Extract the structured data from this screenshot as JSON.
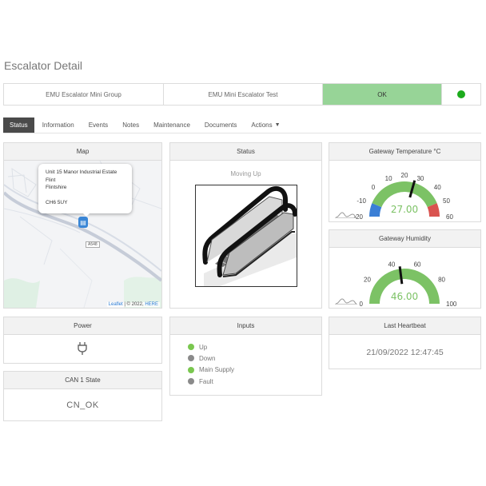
{
  "page": {
    "title": "Escalator Detail"
  },
  "summary": {
    "group": "EMU Escalator Mini Group",
    "device": "EMU Mini Escalator Test",
    "state": "OK",
    "state_color": "#97d497",
    "dot_color": "#1cab1c"
  },
  "tabs": [
    {
      "label": "Status",
      "active": true
    },
    {
      "label": "Information",
      "active": false
    },
    {
      "label": "Events",
      "active": false
    },
    {
      "label": "Notes",
      "active": false
    },
    {
      "label": "Maintenance",
      "active": false
    },
    {
      "label": "Documents",
      "active": false
    },
    {
      "label": "Actions",
      "active": false,
      "icon": "caret-down-icon"
    }
  ],
  "map": {
    "title": "Map",
    "popup": {
      "line1": "Unit 15 Manor Industrial Estate",
      "line2": "Flint",
      "line3": "Flintshire",
      "postcode": "CH6 5UY"
    },
    "road_label": "A548",
    "attribution_leaflet": "Leaflet",
    "attribution_mid": " | © 2022, ",
    "attribution_here": "HERE",
    "marker_icon": "escalator-marker-icon"
  },
  "status": {
    "title": "Status",
    "text": "Moving Up",
    "image": "escalator-illustration"
  },
  "temperature": {
    "title": "Gateway Temperature °C",
    "value": "27.00",
    "numeric": 27,
    "min": -20,
    "max": 60,
    "ticks": [
      "-20",
      "-10",
      "0",
      "10",
      "20",
      "30",
      "40",
      "50",
      "60"
    ],
    "colors": {
      "cold": "#3a7fd6",
      "normal": "#7cc265",
      "hot": "#d9534f"
    }
  },
  "humidity": {
    "title": "Gateway Humidity",
    "value": "46.00",
    "numeric": 46,
    "min": 0,
    "max": 100,
    "ticks": [
      "0",
      "20",
      "40",
      "60",
      "80",
      "100"
    ],
    "color": "#7cc265"
  },
  "power": {
    "title": "Power",
    "icon": "plug-icon"
  },
  "inputs": {
    "title": "Inputs",
    "items": [
      {
        "label": "Up",
        "state": "on"
      },
      {
        "label": "Down",
        "state": "off"
      },
      {
        "label": "Main Supply",
        "state": "on"
      },
      {
        "label": "Fault",
        "state": "off"
      }
    ]
  },
  "heartbeat": {
    "title": "Last Heartbeat",
    "value": "21/09/2022 12:47:45"
  },
  "can": {
    "title": "CAN 1 State",
    "value": "CN_OK"
  }
}
